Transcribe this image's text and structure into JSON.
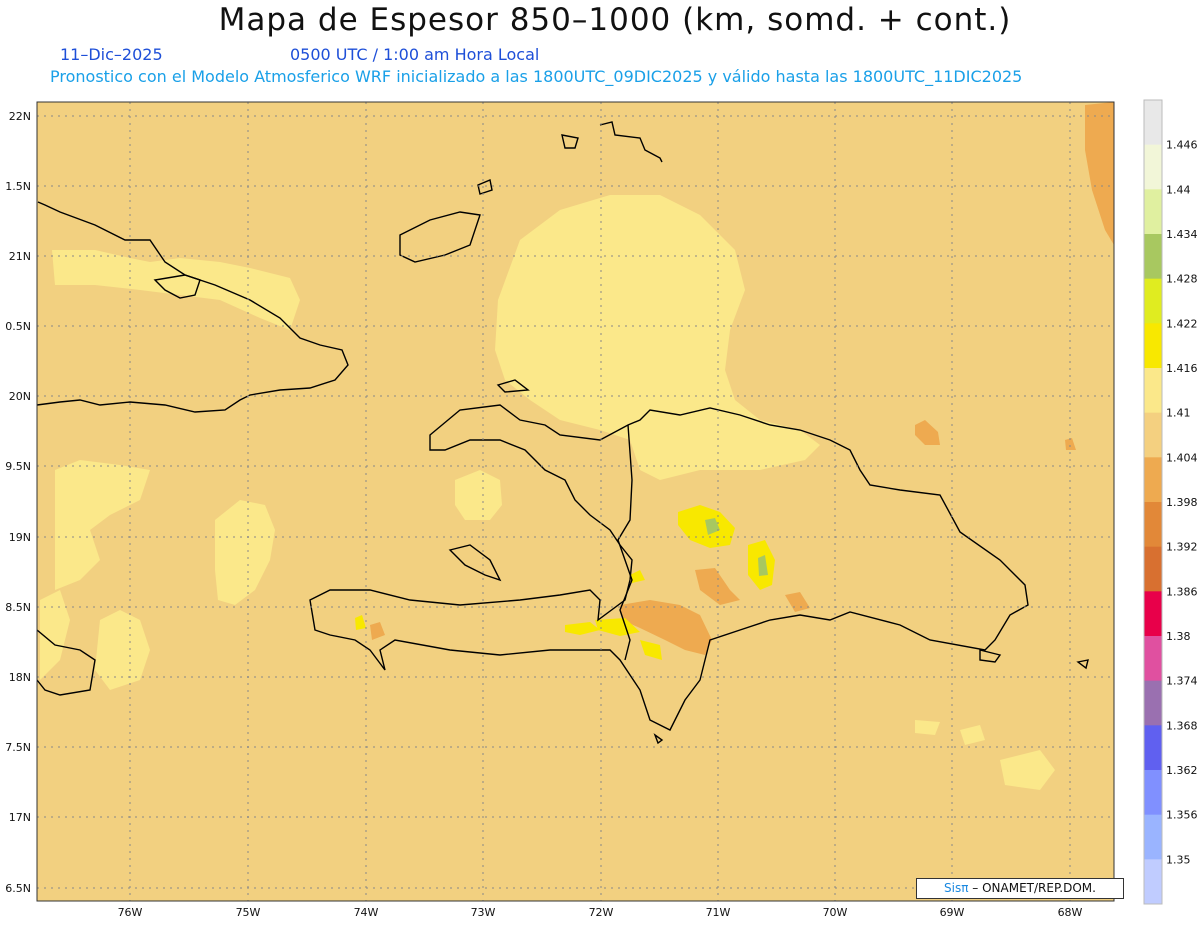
{
  "title": "Mapa de Espesor 850–1000 (km, somd. + cont.)",
  "date_label": "11–Dic–2025",
  "time_label": "0500 UTC / 1:00 am Hora Local",
  "forecast_label": "Pronostico con el Modelo Atmosferico WRF inicializado a las 1800UTC_09DIC2025 y válido hasta las  1800UTC_11DIC2025",
  "credit": {
    "brand": "Sisπ",
    "text": "– ONAMET/REP.DOM."
  },
  "axes": {
    "lat_labels": [
      "22N",
      "1.5N",
      "21N",
      "0.5N",
      "20N",
      "9.5N",
      "19N",
      "8.5N",
      "18N",
      "7.5N",
      "17N",
      "6.5N"
    ],
    "lon_labels": [
      "76W",
      "75W",
      "74W",
      "73W",
      "72W",
      "71W",
      "70W",
      "69W",
      "68W"
    ]
  },
  "colorbar": {
    "levels": [
      "1.446",
      "1.44",
      "1.434",
      "1.428",
      "1.422",
      "1.416",
      "1.41",
      "1.404",
      "1.398",
      "1.392",
      "1.386",
      "1.38",
      "1.374",
      "1.368",
      "1.362",
      "1.356",
      "1.35"
    ],
    "colors": [
      "#e8e8e8",
      "#f2f6d8",
      "#e0f0a0",
      "#a8c860",
      "#e0ec20",
      "#f8e800",
      "#fbe88a",
      "#f4d080",
      "#eeaa50",
      "#e28838",
      "#d87030",
      "#e8004a",
      "#e050a0",
      "#9a70b0",
      "#6060f0",
      "#8090ff",
      "#9ab4ff",
      "#c0ccff"
    ]
  },
  "map": {
    "background_color": "#f2d080",
    "ocean_band_color": "#f4d08a"
  }
}
